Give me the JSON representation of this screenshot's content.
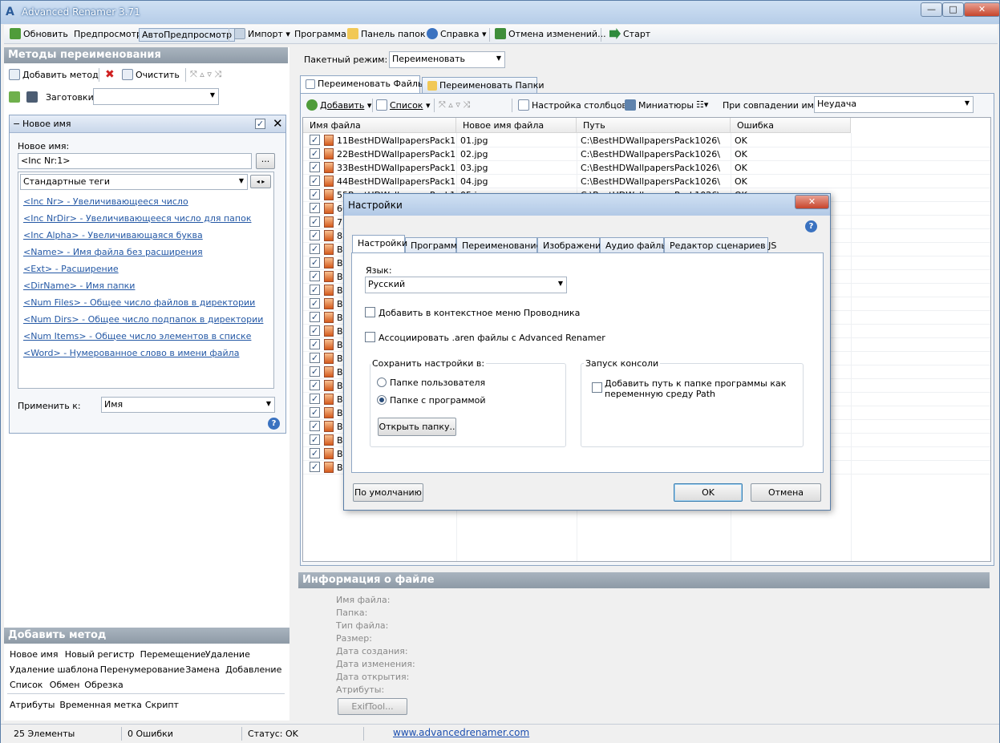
{
  "window": {
    "title": "Advanced Renamer 3.71"
  },
  "toolbar": {
    "refresh": "Обновить",
    "preview": "Предпросмотр",
    "autopreview": "АвтоПредпросмотр",
    "import": "Импорт",
    "program": "Программа",
    "folder_panel": "Панель папок",
    "help": "Справка",
    "undo": "Отмена изменений...",
    "start": "Старт"
  },
  "methods": {
    "header": "Методы переименования",
    "add_method": "Добавить метод",
    "clear": "Очистить",
    "presets_label": "Заготовки:",
    "presets_value": ""
  },
  "method_panel": {
    "title": "Новое имя",
    "new_name_label": "Новое имя:",
    "new_name_value": "<Inc Nr:1>",
    "browse": "...",
    "tags_combo": "Стандартные теги",
    "tags": [
      "<Inc Nr> - Увеличивающееся число",
      "<Inc NrDir> - Увеличивающееся число для папок",
      "<Inc Alpha> - Увеличивающаяся буква",
      "<Name> - Имя файла без расширения",
      "<Ext> - Расширение",
      "<DirName> - Имя папки",
      "<Num Files> - Общее число файлов в директории",
      "<Num Dirs> - Общее число подпапок в директории",
      "<Num Items> - Общее число элементов в списке",
      "<Word> - Нумерованное слово в имени файла"
    ],
    "apply_to_label": "Применить к:",
    "apply_to_value": "Имя"
  },
  "add_method": {
    "header": "Добавить метод",
    "row1": [
      "Новое имя",
      "Новый регистр",
      "Перемещение",
      "Удаление"
    ],
    "row2": [
      "Удаление шаблона",
      "Перенумерование",
      "Замена",
      "Добавление"
    ],
    "row3": [
      "Список",
      "Обмен",
      "Обрезка"
    ],
    "row4": [
      "Атрибуты",
      "Временная метка",
      "Скрипт"
    ]
  },
  "batch": {
    "label": "Пакетный режим:",
    "value": "Переименовать"
  },
  "tabs": {
    "files": "Переименовать Файлы",
    "folders": "Переименовать Папки"
  },
  "list_toolbar": {
    "add": "Добавить",
    "list": "Список",
    "columns": "Настройка столбцов",
    "thumbs": "Миниатюры",
    "collision_label": "При совпадении имен:",
    "collision_value": "Неудача"
  },
  "grid": {
    "columns": [
      "Имя файла",
      "Новое имя файла",
      "Путь",
      "Ошибка"
    ],
    "rows": [
      {
        "name": "11BestHDWallpapersPack10...",
        "new": "01.jpg",
        "path": "C:\\BestHDWallpapersPack1026\\",
        "err": "OK"
      },
      {
        "name": "22BestHDWallpapersPack10...",
        "new": "02.jpg",
        "path": "C:\\BestHDWallpapersPack1026\\",
        "err": "OK"
      },
      {
        "name": "33BestHDWallpapersPack10...",
        "new": "03.jpg",
        "path": "C:\\BestHDWallpapersPack1026\\",
        "err": "OK"
      },
      {
        "name": "44BestHDWallpapersPack10...",
        "new": "04.jpg",
        "path": "C:\\BestHDWallpapersPack1026\\",
        "err": "OK"
      },
      {
        "name": "55BestHDWallpapersPack10...",
        "new": "05.jpg",
        "path": "C:\\BestHDWallpapersPack1026\\",
        "err": "OK"
      },
      {
        "name": "66",
        "new": "",
        "path": "",
        "err": ""
      },
      {
        "name": "77",
        "new": "",
        "path": "",
        "err": ""
      },
      {
        "name": "88",
        "new": "",
        "path": "",
        "err": ""
      },
      {
        "name": "Be",
        "new": "",
        "path": "",
        "err": ""
      },
      {
        "name": "Be",
        "new": "",
        "path": "",
        "err": ""
      },
      {
        "name": "Be",
        "new": "",
        "path": "",
        "err": ""
      },
      {
        "name": "Be",
        "new": "",
        "path": "",
        "err": ""
      },
      {
        "name": "Be",
        "new": "",
        "path": "",
        "err": ""
      },
      {
        "name": "Be",
        "new": "",
        "path": "",
        "err": ""
      },
      {
        "name": "Be",
        "new": "",
        "path": "",
        "err": ""
      },
      {
        "name": "Be",
        "new": "",
        "path": "",
        "err": ""
      },
      {
        "name": "Be",
        "new": "",
        "path": "",
        "err": ""
      },
      {
        "name": "Be",
        "new": "",
        "path": "",
        "err": ""
      },
      {
        "name": "Be",
        "new": "",
        "path": "",
        "err": ""
      },
      {
        "name": "Be",
        "new": "",
        "path": "",
        "err": ""
      },
      {
        "name": "Be",
        "new": "",
        "path": "",
        "err": ""
      },
      {
        "name": "Be",
        "new": "",
        "path": "",
        "err": ""
      },
      {
        "name": "Be",
        "new": "",
        "path": "",
        "err": ""
      },
      {
        "name": "Be",
        "new": "",
        "path": "",
        "err": ""
      },
      {
        "name": "Be",
        "new": "",
        "path": "",
        "err": ""
      }
    ]
  },
  "fileinfo": {
    "header": "Информация о файле",
    "fields": [
      "Имя файла:",
      "Папка:",
      "Тип файла:",
      "Размер:",
      "Дата создания:",
      "Дата изменения:",
      "Дата открытия:",
      "Атрибуты:"
    ],
    "exiftool": "ExifTool..."
  },
  "dialog": {
    "title": "Настройки",
    "tabs": [
      "Настройки",
      "Программа",
      "Переименование",
      "Изображения",
      "Аудио файлы",
      "Редактор сценариев JS"
    ],
    "language_label": "Язык:",
    "language_value": "Русский",
    "ctx_menu": "Добавить в контекстное меню Проводника",
    "assoc": "Ассоциировать .aren файлы с Advanced Renamer",
    "save_group": "Сохранить настройки в:",
    "radio_user": "Папке пользователя",
    "radio_program": "Папке с программой",
    "open_folder": "Открыть папку..",
    "console_group": "Запуск консоли",
    "console_cb": "Добавить путь к папке программы как переменную среду Path",
    "defaults": "По умолчанию",
    "ok": "OK",
    "cancel": "Отмена"
  },
  "status": {
    "items": "25 Элементы",
    "errors": "0 Ошибки",
    "state": "Статус: OK",
    "url": "www.advancedrenamer.com"
  }
}
